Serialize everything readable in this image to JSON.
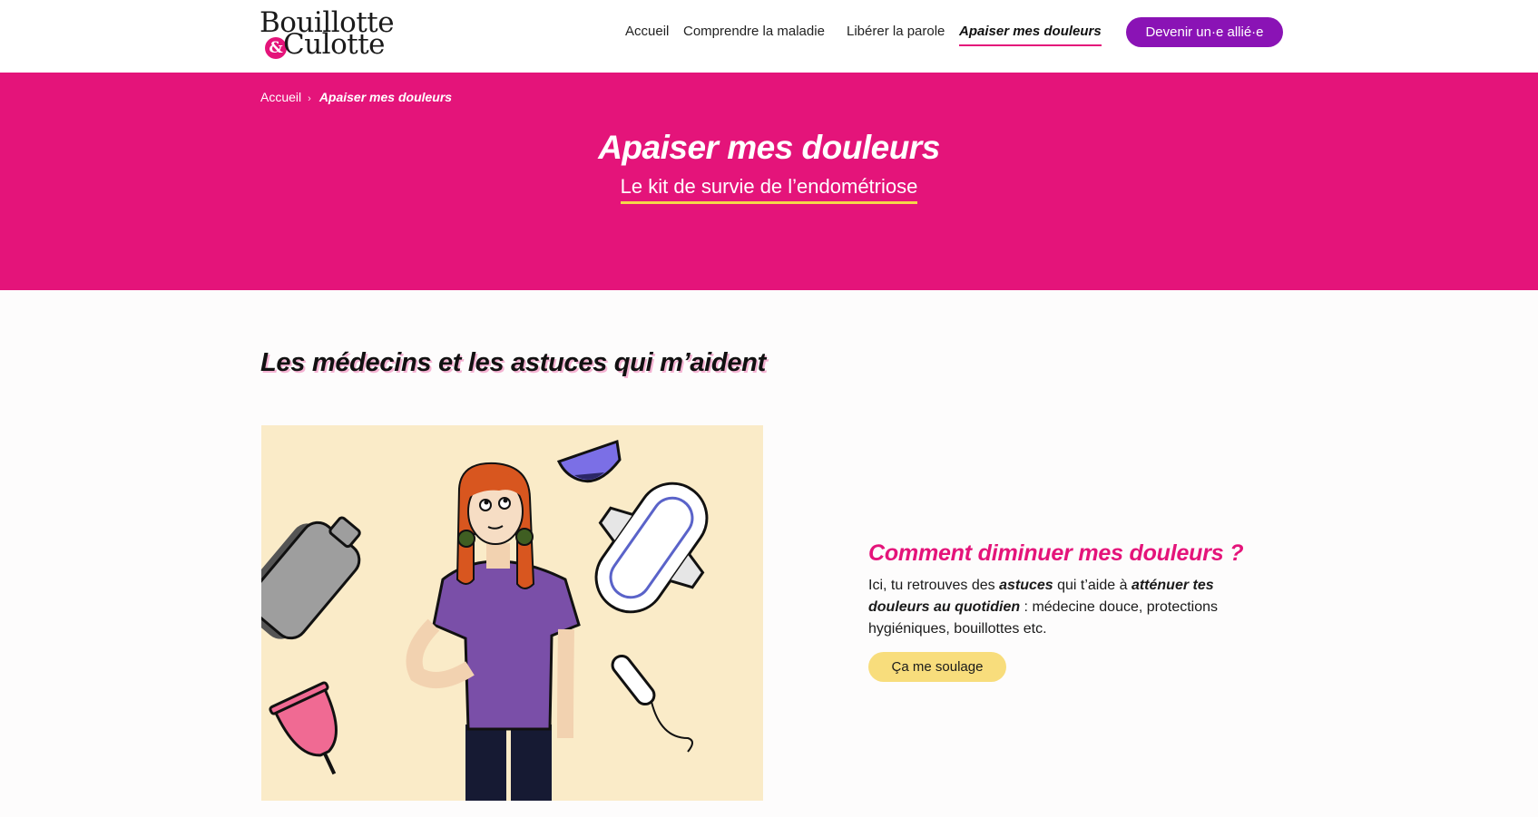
{
  "brand": {
    "logo_line1": "Bouillotte",
    "logo_amp": "&",
    "logo_line2": "Culotte",
    "accent": "#e4147a",
    "cta_color": "#8a13b5",
    "highlight": "#f5d64a"
  },
  "nav": {
    "items": [
      "Accueil",
      "Comprendre la maladie",
      "Libérer la parole",
      "Apaiser mes douleurs"
    ],
    "active": "Apaiser mes douleurs",
    "cta_label": "Devenir un·e allié·e"
  },
  "breadcrumb": {
    "home": "Accueil",
    "separator": "›",
    "current": "Apaiser mes douleurs"
  },
  "hero": {
    "title": "Apaiser mes douleurs",
    "subtitle": "Le kit de survie de l’endométriose"
  },
  "main": {
    "section_title": "Les médecins et les astuces qui m’aident",
    "card": {
      "title": "Comment diminuer mes douleurs ?",
      "text_1": "Ici, tu retrouves des ",
      "text_b1": "astuces",
      "text_2": " qui t’aide à ",
      "text_b2": "atténuer tes douleurs au quotidien",
      "text_3": " : médecine douce, protections hygiéniques, bouillottes etc.",
      "button_label": "Ça me soulage"
    }
  },
  "illustration": {
    "icons": [
      "hot-water-bottle-icon",
      "period-underwear-icon",
      "sanitary-pad-icon",
      "menstrual-cup-icon",
      "tampon-icon",
      "woman-illustration"
    ]
  }
}
